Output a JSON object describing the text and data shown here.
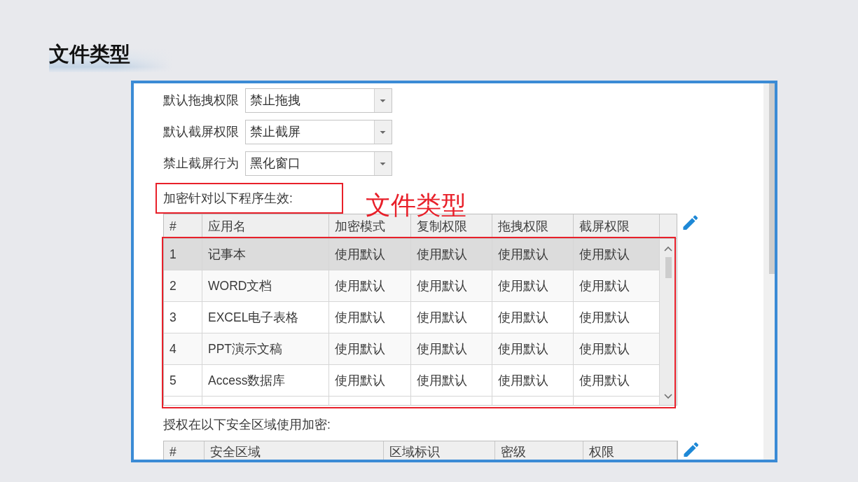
{
  "page_title": "文件类型",
  "settings": [
    {
      "label": "默认拖拽权限",
      "value": "禁止拖拽"
    },
    {
      "label": "默认截屏权限",
      "value": "禁止截屏"
    },
    {
      "label": "禁止截屏行为",
      "value": "黑化窗口"
    }
  ],
  "program_section": {
    "label": "加密针对以下程序生效:",
    "label_highlighted": true,
    "annotation": "文件类型",
    "table": {
      "columns": [
        "#",
        "应用名",
        "加密模式",
        "复制权限",
        "拖拽权限",
        "截屏权限"
      ],
      "rows_highlighted": true,
      "rows": [
        {
          "cells": [
            "1",
            "记事本",
            "使用默认",
            "使用默认",
            "使用默认",
            "使用默认"
          ],
          "selected": true
        },
        {
          "cells": [
            "2",
            "WORD文档",
            "使用默认",
            "使用默认",
            "使用默认",
            "使用默认"
          ],
          "selected": false
        },
        {
          "cells": [
            "3",
            "EXCEL电子表格",
            "使用默认",
            "使用默认",
            "使用默认",
            "使用默认"
          ],
          "selected": false
        },
        {
          "cells": [
            "4",
            "PPT演示文稿",
            "使用默认",
            "使用默认",
            "使用默认",
            "使用默认"
          ],
          "selected": false
        },
        {
          "cells": [
            "5",
            "Access数据库",
            "使用默认",
            "使用默认",
            "使用默认",
            "使用默认"
          ],
          "selected": false
        }
      ]
    }
  },
  "zone_section": {
    "label": "授权在以下安全区域使用加密:",
    "table": {
      "columns": [
        "#",
        "安全区域",
        "区域标识",
        "密级",
        "权限"
      ]
    }
  }
}
